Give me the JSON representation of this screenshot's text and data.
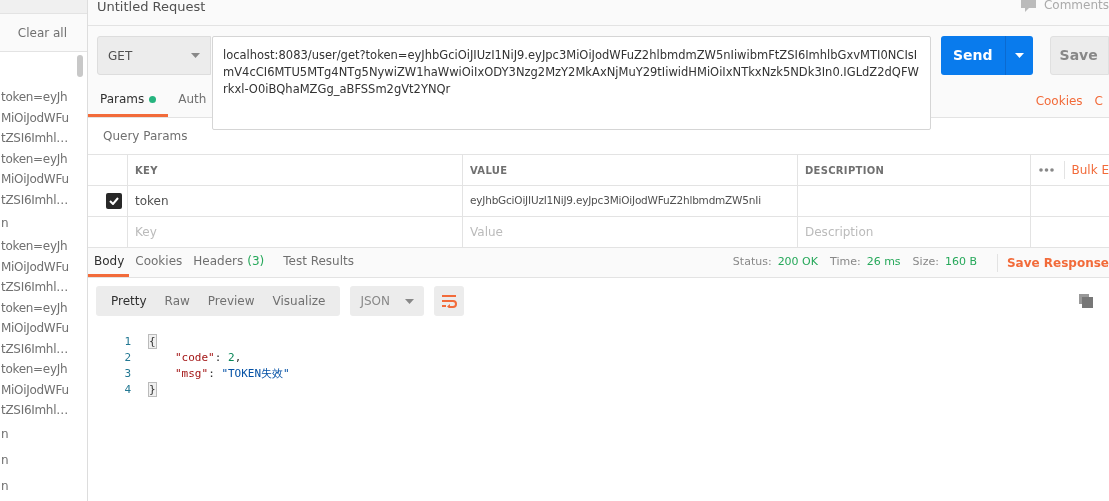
{
  "sidebar": {
    "clear_all": "Clear all",
    "history": [
      {
        "lines": [
          "token=eyJh",
          "MiOiJodWFu",
          "tZSI6Imhl…"
        ]
      },
      {
        "lines": [
          "token=eyJh",
          "MiOiJodWFu",
          "tZSI6Imhl…"
        ]
      },
      {
        "lines": [
          "n"
        ]
      },
      {
        "lines": [
          "token=eyJh",
          "MiOiJodWFu",
          "tZSI6Imhl…"
        ]
      },
      {
        "lines": [
          "token=eyJh",
          "MiOiJodWFu",
          "tZSI6Imhl…"
        ]
      },
      {
        "lines": [
          "token=eyJh",
          "MiOiJodWFu",
          "tZSI6Imhl…"
        ]
      },
      {
        "lines": [
          "n"
        ]
      },
      {
        "lines": [
          "n"
        ]
      },
      {
        "lines": [
          "n"
        ]
      }
    ]
  },
  "request": {
    "title": "Untitled Request",
    "comments": "Comments",
    "method": "GET",
    "url": "localhost:8083/user/get?token=eyJhbGciOiJIUzI1NiJ9.eyJpc3MiOiJodWFuZ2hlbmdmZW5nIiwibmFtZSI6ImhlbGxvMTI0NCIsImV4cCI6MTU5MTg4NTg5NywiZW1haWwiOiIxODY3Nzg2MzY2MkAxNjMuY29tIiwidHMiOiIxNTkxNzk5NDk3In0.IGLdZ2dQFWrkxl-O0iBQhaMZGg_aBFSSm2gVt2YNQr",
    "send": "Send",
    "save": "Save"
  },
  "request_tabs": [
    {
      "label": "Params",
      "selected": true,
      "dot": true
    },
    {
      "label": "Auth",
      "selected": false,
      "dot": false
    }
  ],
  "request_links": [
    "Cookies",
    "C"
  ],
  "query_params": {
    "title": "Query Params",
    "columns": [
      "KEY",
      "VALUE",
      "DESCRIPTION"
    ],
    "bulk_edit": "Bulk E",
    "rows": [
      {
        "checked": true,
        "key": "token",
        "value": "eyJhbGciOiJIUzI1NiJ9.eyJpc3MiOiJodWFuZ2hlbmdmZW5nIi"
      }
    ],
    "new_row": [
      {
        "placeholder": "Key"
      },
      {
        "placeholder": "Value"
      },
      {
        "placeholder": "Description"
      }
    ]
  },
  "response_tabs": [
    {
      "label": "Body",
      "selected": true
    },
    {
      "label": "Cookies",
      "selected": false
    },
    {
      "label": "Headers",
      "count": "(3)",
      "selected": false
    },
    {
      "label": "Test Results",
      "selected": false
    }
  ],
  "response_meta": [
    {
      "label": "Status:",
      "value": "200 OK"
    },
    {
      "label": "Time:",
      "value": "26 ms"
    },
    {
      "label": "Size:",
      "value": "160 B"
    }
  ],
  "save_response": "Save Response",
  "view_modes": [
    {
      "label": "Pretty",
      "selected": true
    },
    {
      "label": "Raw",
      "selected": false
    },
    {
      "label": "Preview",
      "selected": false
    },
    {
      "label": "Visualize",
      "selected": false
    }
  ],
  "format": "JSON",
  "wrap_on": true,
  "code": [
    {
      "number": "1",
      "tokens": [
        {
          "kind": "brace",
          "text": "{"
        }
      ]
    },
    {
      "number": "2",
      "tokens": [
        {
          "kind": "key",
          "text": "\"code\""
        },
        {
          "kind": "punct",
          "text": ": "
        },
        {
          "kind": "number",
          "text": "2"
        },
        {
          "kind": "punct",
          "text": ","
        }
      ]
    },
    {
      "number": "3",
      "tokens": [
        {
          "kind": "key",
          "text": "\"msg\""
        },
        {
          "kind": "punct",
          "text": ": "
        },
        {
          "kind": "string",
          "text": "\"TOKEN失效\""
        }
      ]
    },
    {
      "number": "4",
      "tokens": [
        {
          "kind": "brace",
          "text": "}"
        }
      ]
    }
  ]
}
